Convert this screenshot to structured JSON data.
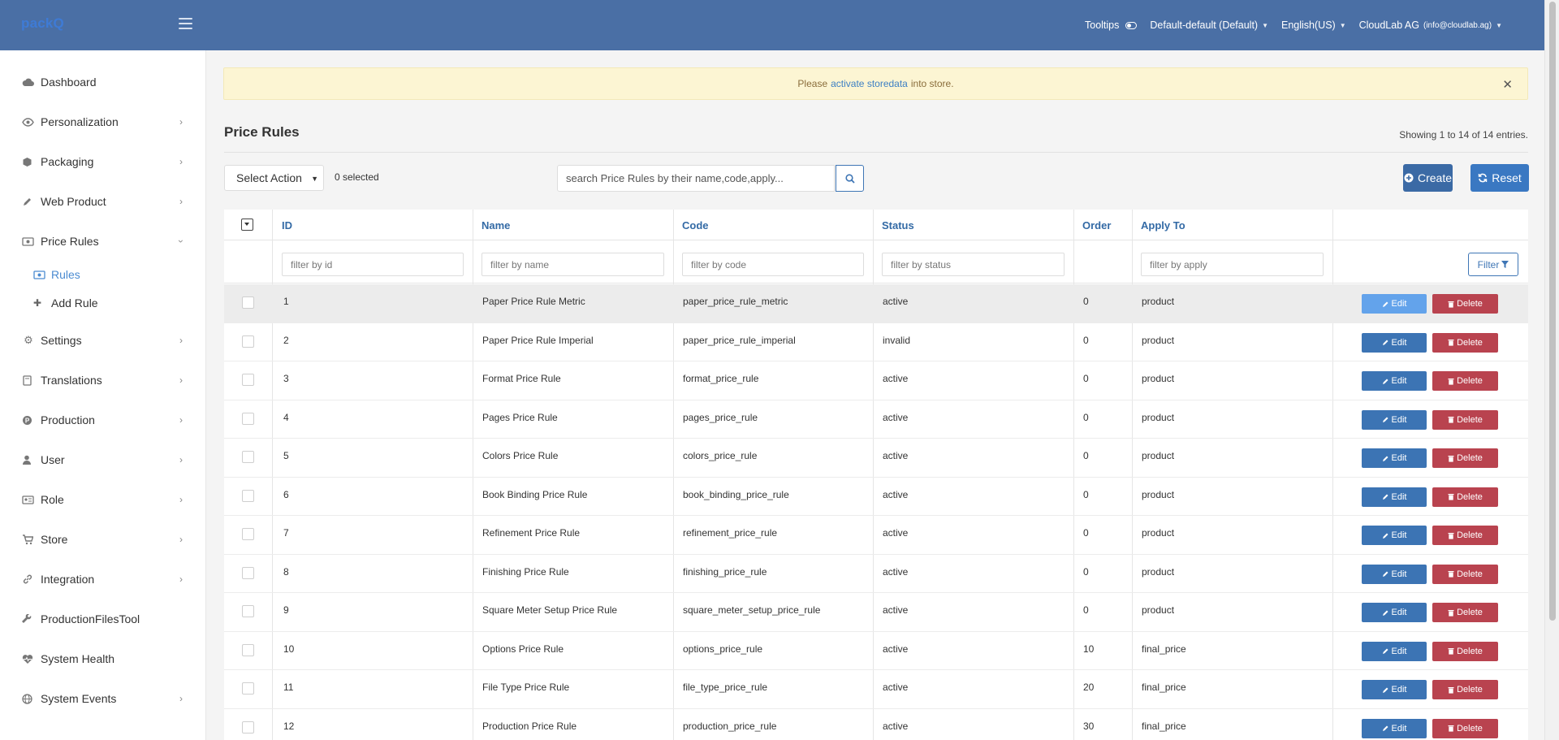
{
  "app": {
    "logo": "packQ"
  },
  "topbar": {
    "tooltips_label": "Tooltips",
    "store_selector": "Default-default (Default)",
    "language": "English(US)",
    "account_name": "CloudLab AG",
    "account_email": "(info@cloudlab.ag)"
  },
  "sidebar": {
    "items": [
      {
        "label": "Dashboard",
        "icon": "cloud-icon"
      },
      {
        "label": "Personalization",
        "icon": "eye-icon"
      },
      {
        "label": "Packaging",
        "icon": "box-icon"
      },
      {
        "label": "Web Product",
        "icon": "pencil-icon"
      },
      {
        "label": "Price Rules",
        "icon": "money-icon"
      },
      {
        "label": "Settings",
        "icon": "gears-icon"
      },
      {
        "label": "Translations",
        "icon": "book-icon"
      },
      {
        "label": "Production",
        "icon": "production-icon"
      },
      {
        "label": "User",
        "icon": "user-icon"
      },
      {
        "label": "Role",
        "icon": "id-card-icon"
      },
      {
        "label": "Store",
        "icon": "cart-icon"
      },
      {
        "label": "Integration",
        "icon": "link-icon"
      },
      {
        "label": "ProductionFilesTool",
        "icon": "wrench-icon"
      },
      {
        "label": "System Health",
        "icon": "heartbeat-icon"
      },
      {
        "label": "System Events",
        "icon": "globe-icon"
      }
    ],
    "price_rules_sub": [
      {
        "label": "Rules",
        "icon": "money-icon",
        "active": true
      },
      {
        "label": "Add Rule",
        "icon": "plus-icon",
        "active": false
      }
    ]
  },
  "alert": {
    "before": "Please",
    "link": "activate storedata",
    "after": "into store."
  },
  "page": {
    "title": "Price Rules",
    "showing": "Showing 1 to 14 of 14 entries."
  },
  "toolbar": {
    "select_action": "Select Action",
    "selected_count": "0 selected",
    "search_placeholder": "search Price Rules by their name,code,apply...",
    "create_label": "Create",
    "reset_label": "Reset"
  },
  "table": {
    "headers": {
      "id": "ID",
      "name": "Name",
      "code": "Code",
      "status": "Status",
      "order": "Order",
      "apply_to": "Apply To"
    },
    "filters": {
      "id": "filter by id",
      "name": "filter by name",
      "code": "filter by code",
      "status": "filter by status",
      "apply": "filter by apply",
      "filter_button": "Filter"
    },
    "edit_label": "Edit",
    "delete_label": "Delete",
    "rows": [
      {
        "id": "1",
        "name": "Paper Price Rule Metric",
        "code": "paper_price_rule_metric",
        "status": "active",
        "order": "0",
        "apply_to": "product"
      },
      {
        "id": "2",
        "name": "Paper Price Rule Imperial",
        "code": "paper_price_rule_imperial",
        "status": "invalid",
        "order": "0",
        "apply_to": "product"
      },
      {
        "id": "3",
        "name": "Format Price Rule",
        "code": "format_price_rule",
        "status": "active",
        "order": "0",
        "apply_to": "product"
      },
      {
        "id": "4",
        "name": "Pages Price Rule",
        "code": "pages_price_rule",
        "status": "active",
        "order": "0",
        "apply_to": "product"
      },
      {
        "id": "5",
        "name": "Colors Price Rule",
        "code": "colors_price_rule",
        "status": "active",
        "order": "0",
        "apply_to": "product"
      },
      {
        "id": "6",
        "name": "Book Binding Price Rule",
        "code": "book_binding_price_rule",
        "status": "active",
        "order": "0",
        "apply_to": "product"
      },
      {
        "id": "7",
        "name": "Refinement Price Rule",
        "code": "refinement_price_rule",
        "status": "active",
        "order": "0",
        "apply_to": "product"
      },
      {
        "id": "8",
        "name": "Finishing Price Rule",
        "code": "finishing_price_rule",
        "status": "active",
        "order": "0",
        "apply_to": "product"
      },
      {
        "id": "9",
        "name": "Square Meter Setup Price Rule",
        "code": "square_meter_setup_price_rule",
        "status": "active",
        "order": "0",
        "apply_to": "product"
      },
      {
        "id": "10",
        "name": "Options Price Rule",
        "code": "options_price_rule",
        "status": "active",
        "order": "10",
        "apply_to": "final_price"
      },
      {
        "id": "11",
        "name": "File Type Price Rule",
        "code": "file_type_price_rule",
        "status": "active",
        "order": "20",
        "apply_to": "final_price"
      },
      {
        "id": "12",
        "name": "Production Price Rule",
        "code": "production_price_rule",
        "status": "active",
        "order": "30",
        "apply_to": "final_price"
      }
    ]
  },
  "colors": {
    "topbar": "#4a6fa5",
    "primary": "#3c74b4",
    "danger": "#b9434f",
    "alert_bg": "#fcf5d3"
  }
}
